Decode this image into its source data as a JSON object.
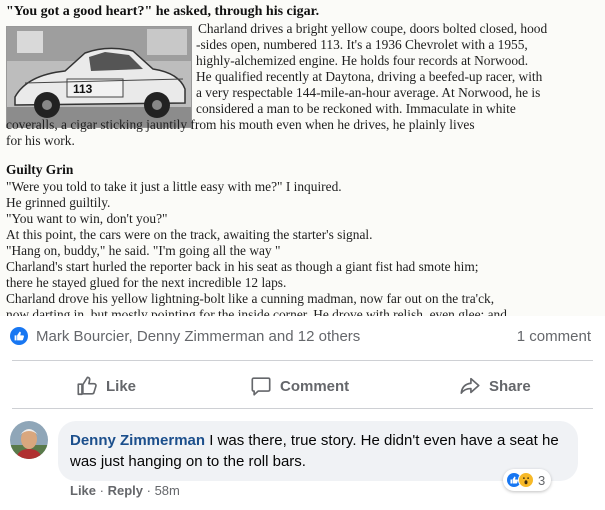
{
  "article": {
    "lines": [
      "\"You got a good heart?\" he asked, through his cigar.",
      "Charland drives a bright yellow coupe, doors bolted closed, hood",
      "-sides open, numbered 113. It's a 1936 Chevrolet with a 1955,",
      "highly-alchemized engine. He holds four records at Norwood.",
      "He qualified recently at Daytona, driving a beefed-up racer, with",
      "a very respectable 144-mile-an-hour average. At Norwood, he is",
      "considered a man to be reckoned with. Immaculate in white",
      "coveralls, a cigar sticking jauntily from his mouth even when he drives, he plainly lives",
      "for his work.",
      "Guilty Grin",
      "\"Were you told to take it just a little easy with me?\" I inquired.",
      "He grinned guiltily.",
      "\"You want to win, don't you?\"",
      "At this point, the cars were on the track, awaiting the starter's signal.",
      "\"Hang on, buddy,\" he said. \"I'm going all the way \"",
      "Charland's start hurled the reporter back in his seat as though a giant fist had smote him;",
      "there he stayed glued for the next incredible 12 laps.",
      "Charland drove his yellow lightning-bolt like a cunning madman, now far out on the tra'ck,",
      "now darting in, but mostly pointing for the inside corner. He drove with relish, even glee; and"
    ],
    "car_number": "113"
  },
  "reactions": {
    "reactors_text": "Mark Bourcier, Denny Zimmerman and 12 others",
    "comment_count": "1 comment"
  },
  "actions": {
    "like": "Like",
    "comment": "Comment",
    "share": "Share"
  },
  "comment": {
    "author": "Denny Zimmerman",
    "text": " I was there, true story. He didn't even have a seat he was just hanging on to the roll bars.",
    "reaction_count": "3",
    "like_link": "Like",
    "reply_link": "Reply",
    "time": "58m"
  },
  "colors": {
    "facebook_blue": "#1877f2",
    "muted_text": "#65676b",
    "bubble_bg": "#f0f2f5",
    "author_link": "#1c4f8c",
    "haha_yellow": "#f7b928"
  }
}
